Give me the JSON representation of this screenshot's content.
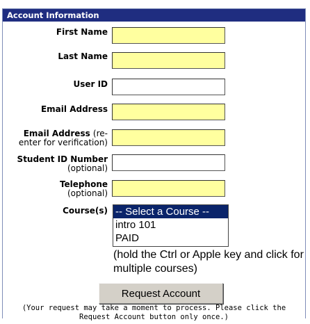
{
  "top_fragment": "",
  "header": {
    "title": "Account Information"
  },
  "fields": {
    "first_name": {
      "label": "First Name",
      "value": ""
    },
    "last_name": {
      "label": "Last Name",
      "value": ""
    },
    "user_id": {
      "label": "User ID",
      "value": ""
    },
    "email": {
      "label": "Email Address",
      "value": ""
    },
    "email_verify": {
      "label": "Email Address",
      "label_inline": "(re-",
      "label_sub": "enter for verification)",
      "value": ""
    },
    "student_id": {
      "label": "Student ID Number",
      "label_sub": "(optional)",
      "value": ""
    },
    "telephone": {
      "label": "Telephone",
      "label_sub": "(optional)",
      "value": ""
    }
  },
  "courses": {
    "label": "Course(s)",
    "options": [
      "-- Select a Course --",
      "intro 101",
      "PAID"
    ],
    "selected_index": 0,
    "hint": "(hold the Ctrl or Apple key and click for multiple courses)"
  },
  "submit": {
    "label": "Request Account"
  },
  "note": {
    "line1": "(Your request may take a moment to process. Please click the",
    "line2": "Request Account button only once.)"
  },
  "colors": {
    "header_bg": "#1f2d80",
    "required_field": "#ffff9f",
    "selected_option": "#0a246a"
  }
}
